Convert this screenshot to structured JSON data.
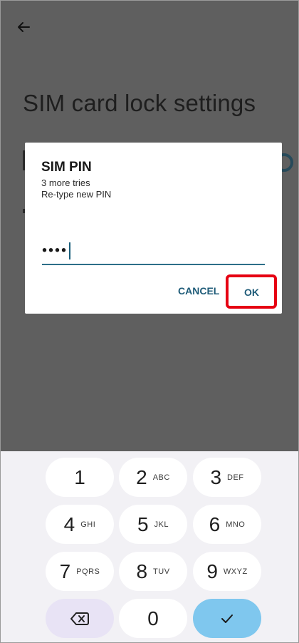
{
  "screen": {
    "title": "SIM card lock settings"
  },
  "dialog": {
    "title": "SIM PIN",
    "tries_text": "3 more tries",
    "instruction": "Re-type new PIN",
    "pin_value": "••••",
    "cancel_label": "CANCEL",
    "ok_label": "OK"
  },
  "keypad": {
    "keys": [
      {
        "num": "1",
        "letters": ""
      },
      {
        "num": "2",
        "letters": "ABC"
      },
      {
        "num": "3",
        "letters": "DEF"
      },
      {
        "num": "4",
        "letters": "GHI"
      },
      {
        "num": "5",
        "letters": "JKL"
      },
      {
        "num": "6",
        "letters": "MNO"
      },
      {
        "num": "7",
        "letters": "PQRS"
      },
      {
        "num": "8",
        "letters": "TUV"
      },
      {
        "num": "9",
        "letters": "WXYZ"
      },
      {
        "num": "0",
        "letters": ""
      }
    ],
    "backspace_icon": "backspace-icon",
    "done_icon": "check-icon"
  },
  "colors": {
    "accent": "#1e5b78",
    "highlight": "#e60012",
    "done_key": "#7fc7ee",
    "delete_key": "#e8e3f5"
  }
}
